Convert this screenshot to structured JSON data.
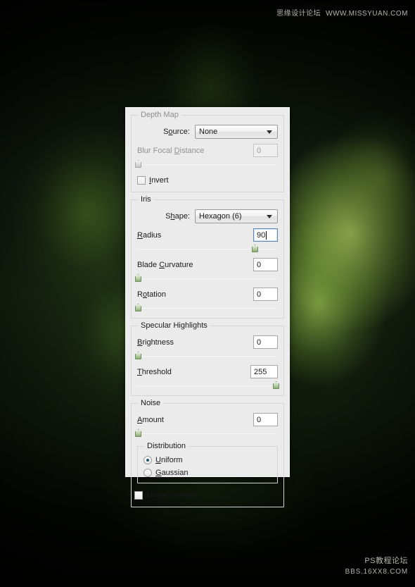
{
  "background": {
    "description": "blurred dark green forest photograph"
  },
  "watermark_top": {
    "cn": "思缘设计论坛",
    "url": "WWW.MISSYUAN.COM"
  },
  "watermark_bottom": {
    "cn": "PS教程论坛",
    "url": "BBS.16XX8.COM"
  },
  "dialog": {
    "depth_map": {
      "legend": "Depth Map",
      "source_label": "Source:",
      "source_value": "None",
      "focal_label": "Blur Focal Distance",
      "focal_value": "0",
      "invert_label": "Invert"
    },
    "iris": {
      "legend": "Iris",
      "shape_label": "Shape:",
      "shape_value": "Hexagon (6)",
      "radius_label": "Radius",
      "radius_value": "90",
      "blade_label": "Blade Curvature",
      "blade_value": "0",
      "rotation_label": "Rotation",
      "rotation_value": "0"
    },
    "specular": {
      "legend": "Specular Highlights",
      "brightness_label": "Brightness",
      "brightness_value": "0",
      "threshold_label": "Threshold",
      "threshold_value": "255"
    },
    "noise": {
      "legend": "Noise",
      "amount_label": "Amount",
      "amount_value": "0",
      "distribution_legend": "Distribution",
      "uniform_label": "Uniform",
      "gaussian_label": "Gaussian",
      "monochromatic_label": "Monochromatic"
    }
  }
}
